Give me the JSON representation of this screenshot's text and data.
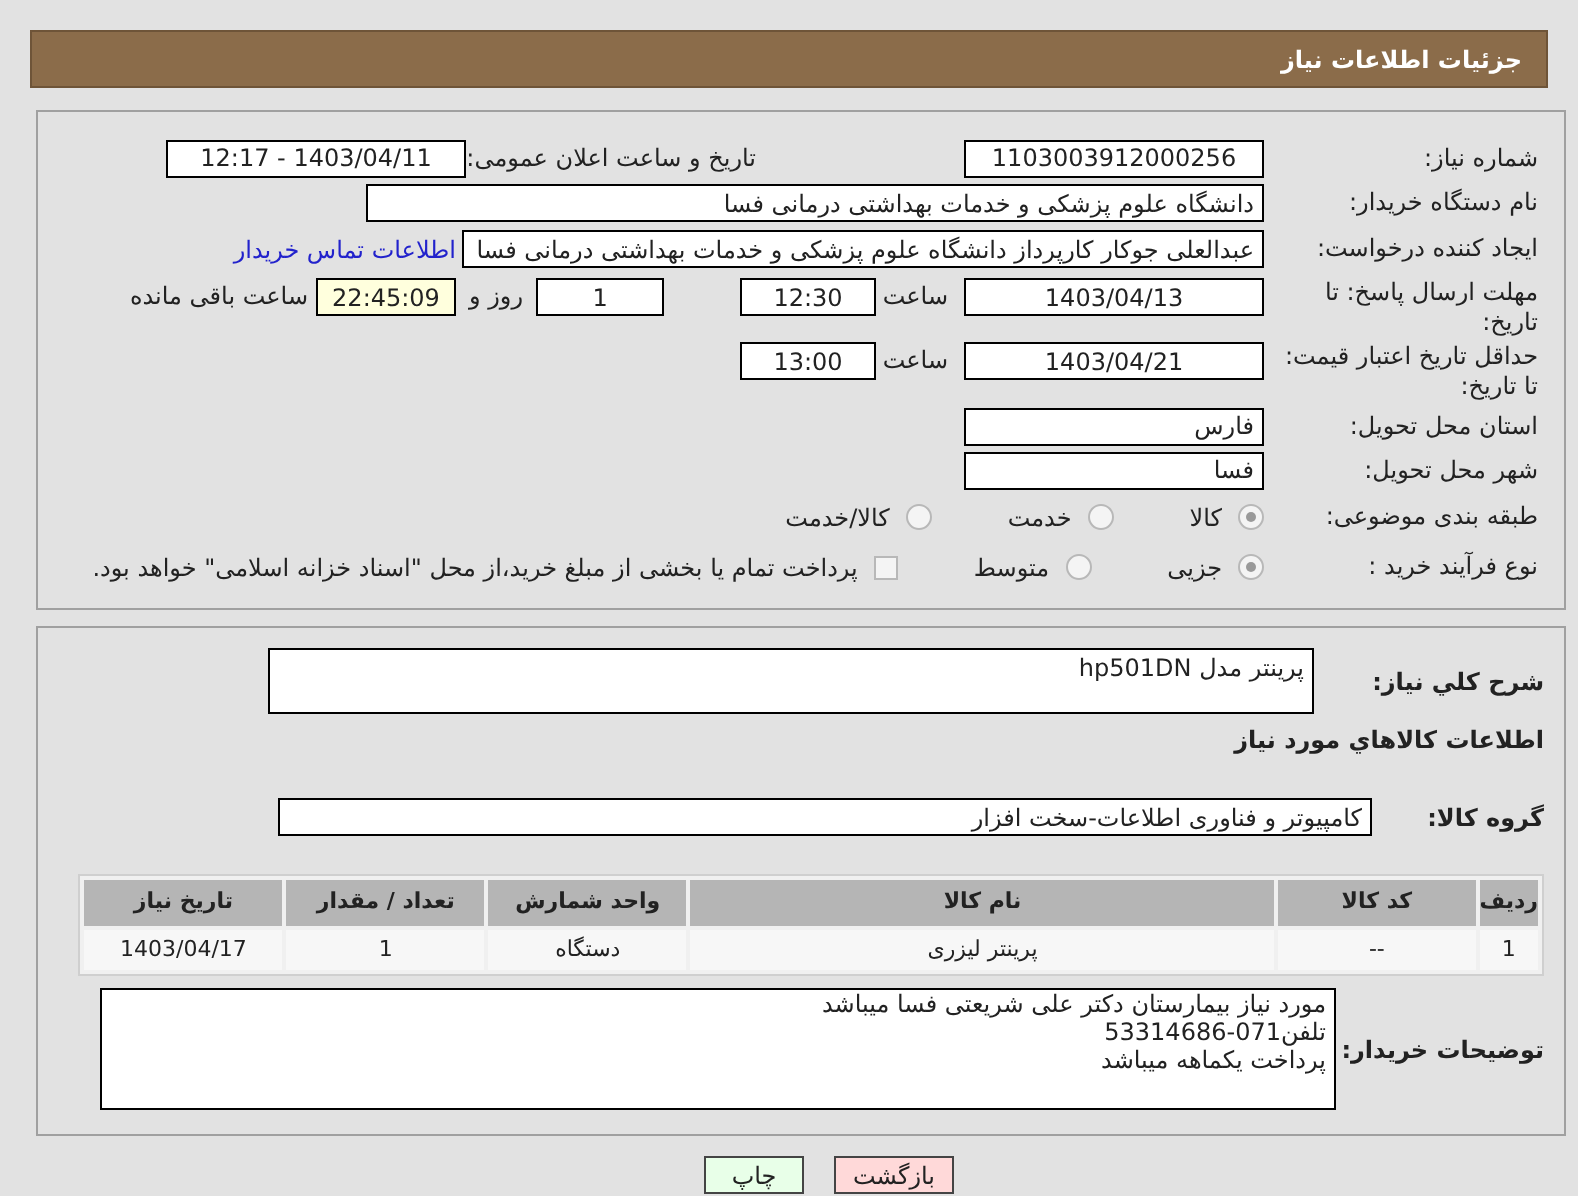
{
  "header": {
    "title": "جزئیات اطلاعات نیاز"
  },
  "need_number": {
    "label": "شماره نیاز:",
    "value": "1103003912000256"
  },
  "announce": {
    "label": "تاریخ و ساعت اعلان عمومی:",
    "value": "1403/04/11 - 12:17"
  },
  "buyer_org": {
    "label": "نام دستگاه خریدار:",
    "value": "دانشگاه علوم پزشکی و خدمات بهداشتی درمانی فسا"
  },
  "requester": {
    "label": "ایجاد کننده درخواست:",
    "value": "عبدالعلی جوکار کارپرداز دانشگاه علوم پزشکی و خدمات بهداشتی درمانی فسا",
    "link": "اطلاعات تماس خریدار"
  },
  "response_deadline": {
    "label": "مهلت ارسال پاسخ: تا تاریخ:",
    "date": "1403/04/13",
    "time_label": "ساعت",
    "time": "12:30",
    "days": "1",
    "days_label": "روز و",
    "remaining": "22:45:09",
    "remaining_label": "ساعت باقی مانده"
  },
  "price_validity": {
    "label": "حداقل تاریخ اعتبار قیمت: تا تاریخ:",
    "date": "1403/04/21",
    "time_label": "ساعت",
    "time": "13:00"
  },
  "province": {
    "label": "استان محل تحویل:",
    "value": "فارس"
  },
  "city": {
    "label": "شهر محل تحویل:",
    "value": "فسا"
  },
  "category": {
    "label": "طبقه بندی موضوعی:",
    "options": [
      {
        "label": "کالا",
        "selected": true
      },
      {
        "label": "خدمت",
        "selected": false
      },
      {
        "label": "کالا/خدمت",
        "selected": false
      }
    ]
  },
  "process": {
    "label": "نوع فرآیند خرید :",
    "options": [
      {
        "label": "جزیی",
        "selected": true
      },
      {
        "label": "متوسط",
        "selected": false
      }
    ],
    "checkbox": {
      "label": "پرداخت تمام یا بخشی از مبلغ خرید،از محل \"اسناد خزانه اسلامی\" خواهد بود.",
      "checked": false
    }
  },
  "description": {
    "label": "شرح كلي نياز:",
    "value": "پرینتر مدل hp501DN"
  },
  "items_title": "اطلاعات كالاهاي مورد نياز",
  "goods_group": {
    "label": "گروه کالا:",
    "value": "کامپیوتر و فناوری اطلاعات-سخت افزار"
  },
  "table": {
    "columns": [
      "ردیف",
      "کد کالا",
      "نام کالا",
      "واحد شمارش",
      "تعداد / مقدار",
      "تاریخ نیاز"
    ],
    "rows": [
      [
        "1",
        "--",
        "پرینتر لیزری",
        "دستگاه",
        "1",
        "1403/04/17"
      ]
    ]
  },
  "buyer_notes": {
    "label": "توضیحات خریدار:",
    "lines": [
      "مورد نیاز بیمارستان دکتر علی شریعتی فسا میباشد",
      "تلفن071-53314686",
      "پرداخت یکماهه میباشد"
    ]
  },
  "buttons": [
    {
      "label": "بازگشت",
      "kind": "back"
    },
    {
      "label": "چاپ",
      "kind": "print"
    }
  ]
}
